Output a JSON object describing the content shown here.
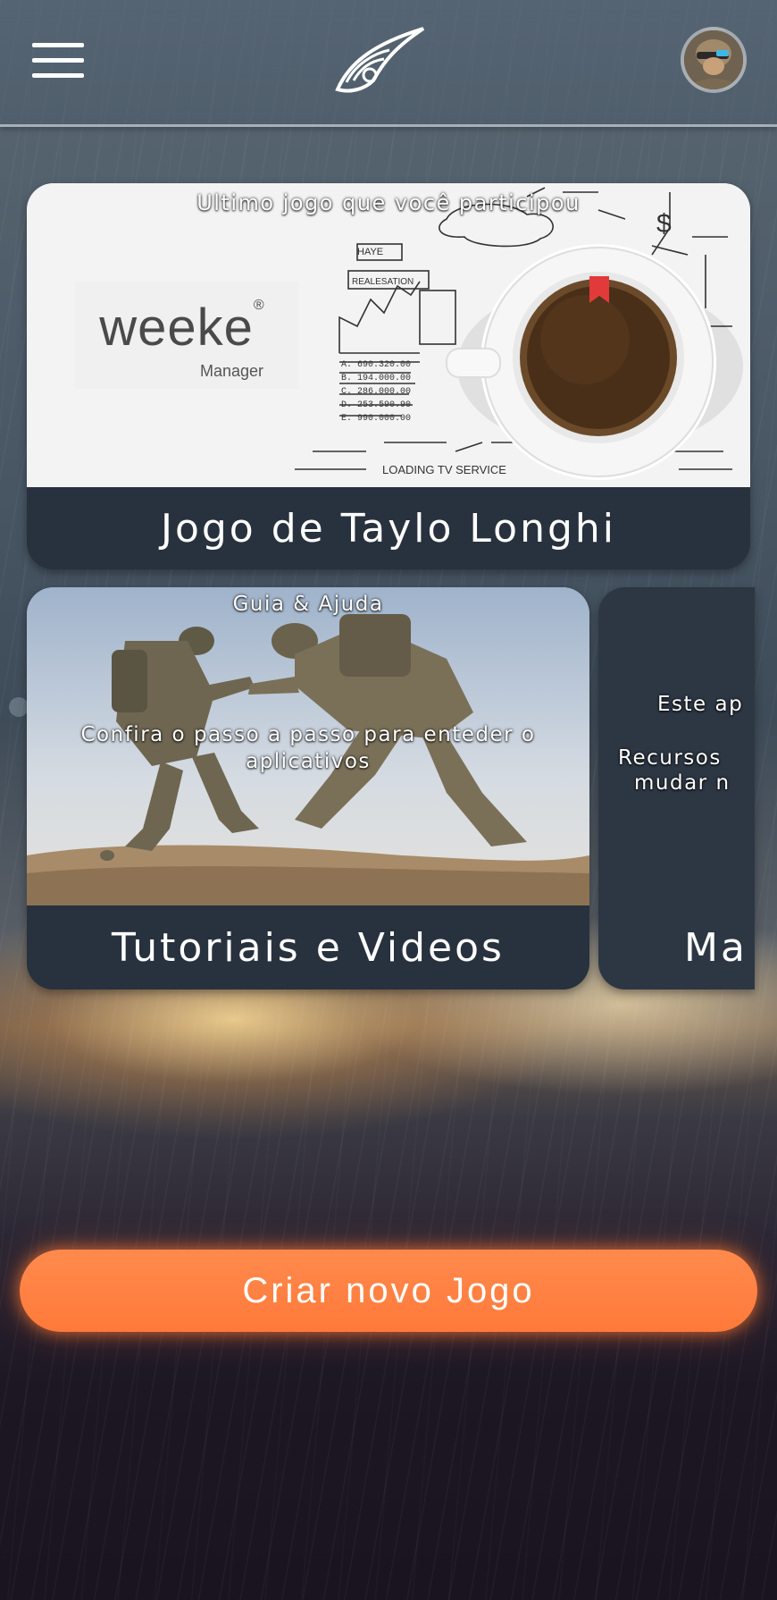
{
  "header": {
    "menu_icon": "hamburger-menu-icon",
    "logo_icon": "eye-swoosh-logo",
    "avatar_icon": "soldier-avatar"
  },
  "cards": {
    "last_game": {
      "caption": "Ultimo jogo que você participou",
      "brand_text": "weeke",
      "brand_registered": "®",
      "brand_sub": "Manager",
      "title": "Jogo de Taylo Longhi"
    },
    "guide": {
      "caption": "Guia & Ajuda",
      "description": "Confira o passo a passo para enteder o aplicativos",
      "title": "Tutoriais e Videos"
    },
    "third": {
      "line1": "Este ap",
      "line2": "Recursos",
      "line3": "mudar n",
      "title": "Ma"
    }
  },
  "cta": {
    "label": "Criar novo Jogo"
  },
  "colors": {
    "accent": "#ff7f40",
    "card_footer": "#283240"
  }
}
